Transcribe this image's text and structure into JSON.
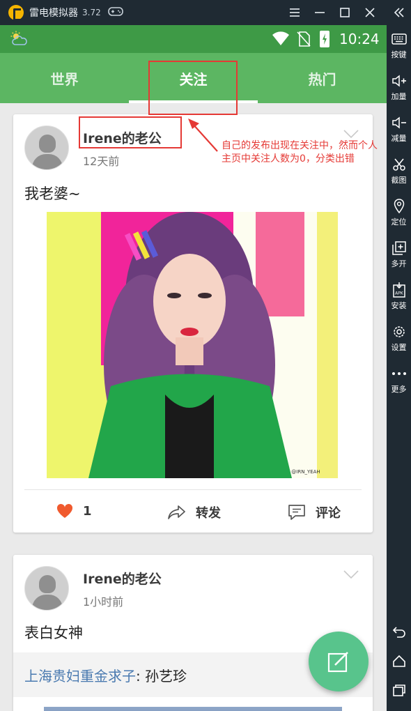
{
  "emulator": {
    "title": "雷电模拟器",
    "version": "3.72",
    "controls": [
      "menu-icon",
      "minimize-icon",
      "maximize-icon",
      "close-icon"
    ],
    "collapse_icon": "double-chevron-left-icon",
    "sidebar": [
      {
        "label": "按键",
        "icon": "keyboard-icon"
      },
      {
        "label": "加量",
        "icon": "volume-up-icon"
      },
      {
        "label": "减量",
        "icon": "volume-down-icon"
      },
      {
        "label": "截图",
        "icon": "scissors-icon"
      },
      {
        "label": "定位",
        "icon": "location-pin-icon"
      },
      {
        "label": "多开",
        "icon": "multi-window-icon"
      },
      {
        "label": "安装",
        "icon": "apk-install-icon"
      },
      {
        "label": "设置",
        "icon": "gear-icon"
      },
      {
        "label": "更多",
        "icon": "more-icon"
      }
    ],
    "nav": [
      "back-icon",
      "home-icon",
      "recents-icon"
    ]
  },
  "statusbar": {
    "time": "10:24"
  },
  "tabs": [
    {
      "label": "世界",
      "active": false
    },
    {
      "label": "关注",
      "active": true
    },
    {
      "label": "热门",
      "active": false
    }
  ],
  "posts": [
    {
      "username": "Irene的老公",
      "time": "12天前",
      "text": "我老婆~",
      "photo_watermark": "@IRN_YEAH",
      "likes": "1",
      "repost_label": "转发",
      "comment_label": "评论"
    },
    {
      "username": "Irene的老公",
      "time": "1小时前",
      "text": "表白女神",
      "link_title": "上海贵妇重金求子",
      "link_sep": ": ",
      "link_author": "孙艺珍"
    }
  ],
  "annotation": {
    "note": "自己的发布出现在关注中，然而个人主页中关注人数为0，分类出错",
    "color": "#e53935"
  },
  "colors": {
    "statusbar": "#3e9a46",
    "tabbar": "#5cb662",
    "fab": "#58c48c",
    "like": "#f05a2e",
    "link": "#4a7ab0"
  }
}
